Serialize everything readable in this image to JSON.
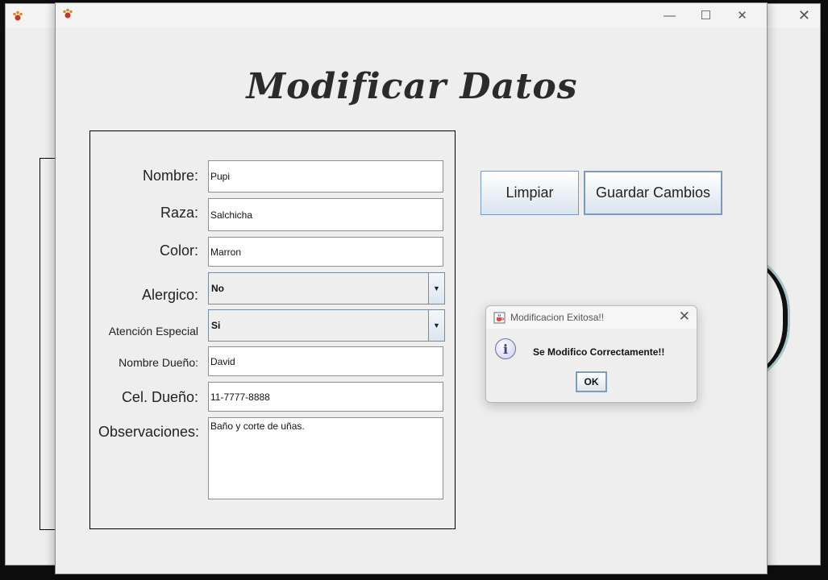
{
  "page_heading": "Modificar Datos",
  "form": {
    "nombre": {
      "label": "Nombre:",
      "value": "Pupi"
    },
    "raza": {
      "label": "Raza:",
      "value": "Salchicha"
    },
    "color": {
      "label": "Color:",
      "value": "Marron"
    },
    "alergico": {
      "label": "Alergico:",
      "value": "No"
    },
    "atencion": {
      "label": "Atención Especial",
      "value": "Si"
    },
    "dueno": {
      "label": "Nombre Dueño:",
      "value": "David"
    },
    "cel": {
      "label": "Cel. Dueño:",
      "value": "11-7777-8888"
    },
    "observaciones": {
      "label": "Observaciones:",
      "value": "Baño y corte de uñas."
    }
  },
  "buttons": {
    "limpiar": "Limpiar",
    "guardar": "Guardar Cambios"
  },
  "dialog": {
    "title": "Modificacion Exitosa!!",
    "message": "Se Modifico Correctamente!!",
    "ok": "OK"
  },
  "icons": {
    "app": "paw-icon",
    "dialog": "java-cup-icon",
    "info": "info-icon"
  },
  "colors": {
    "button_border": "#7d98b8",
    "info_icon": "#3c3c8c"
  }
}
